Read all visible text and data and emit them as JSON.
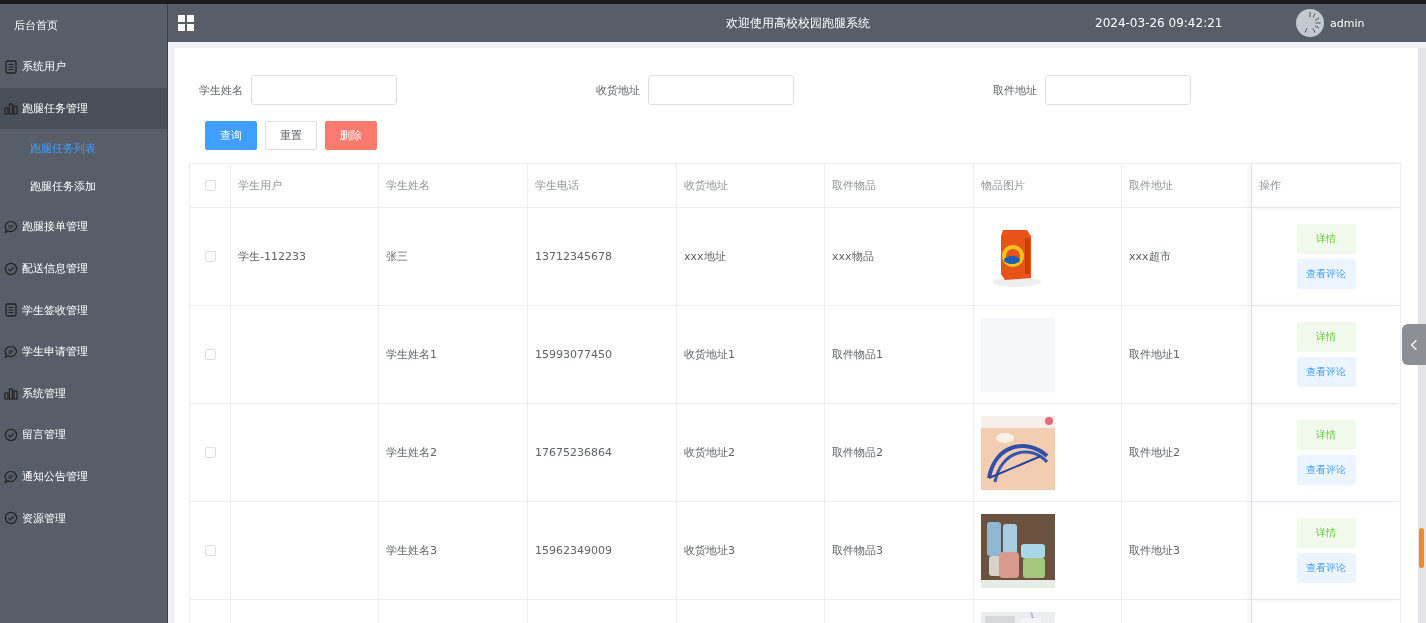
{
  "sidebar": {
    "home": "后台首页",
    "items": [
      {
        "label": "系统用户",
        "kind": "document",
        "expanded": false
      },
      {
        "label": "跑腿任务管理",
        "kind": "chart",
        "expanded": true,
        "children": [
          {
            "label": "跑腿任务列表",
            "selected": true
          },
          {
            "label": "跑腿任务添加",
            "selected": false
          }
        ]
      },
      {
        "label": "跑腿接单管理",
        "kind": "chat",
        "expanded": false
      },
      {
        "label": "配送信息管理",
        "kind": "check",
        "expanded": false
      },
      {
        "label": "学生签收管理",
        "kind": "document",
        "expanded": false
      },
      {
        "label": "学生申请管理",
        "kind": "chat",
        "expanded": false
      },
      {
        "label": "系统管理",
        "kind": "chart",
        "expanded": false
      },
      {
        "label": "留言管理",
        "kind": "check",
        "expanded": false
      },
      {
        "label": "通知公告管理",
        "kind": "chat",
        "expanded": false
      },
      {
        "label": "资源管理",
        "kind": "check",
        "expanded": false
      }
    ]
  },
  "header": {
    "title": "欢迎使用高校校园跑腿系统",
    "datetime": "2024-03-26 09:42:21",
    "user": "admin"
  },
  "filters": [
    {
      "label": "学生姓名"
    },
    {
      "label": "收货地址"
    },
    {
      "label": "取件地址"
    }
  ],
  "buttons": [
    {
      "label": "查询",
      "kind": "primary"
    },
    {
      "label": "重置",
      "kind": "plain"
    },
    {
      "label": "删除",
      "kind": "danger"
    }
  ],
  "table": {
    "header_checked": false,
    "columns": [
      "学生用户",
      "学生姓名",
      "学生电话",
      "收货地址",
      "取件物品",
      "物品图片",
      "取件地址",
      "操作"
    ],
    "rows": [
      {
        "checked": false,
        "cells": [
          "学生-112233",
          "张三",
          "13712345678",
          "xxx地址",
          "xxx物品"
        ],
        "image": {
          "kind": "picture"
        },
        "pickup": "xxx超市",
        "actions": [
          "详情",
          "查看评论"
        ]
      },
      {
        "checked": false,
        "cells": [
          "",
          "学生姓名1",
          "15993077450",
          "收货地址1",
          "取件物品1"
        ],
        "image": {
          "kind": "placeholder"
        },
        "pickup": "取件地址1",
        "actions": [
          "详情",
          "查看评论"
        ]
      },
      {
        "checked": false,
        "cells": [
          "",
          "学生姓名2",
          "17675236864",
          "收货地址2",
          "取件物品2"
        ],
        "image": {
          "kind": "picture"
        },
        "pickup": "取件地址2",
        "actions": [
          "详情",
          "查看评论"
        ]
      },
      {
        "checked": false,
        "cells": [
          "",
          "学生姓名3",
          "15962349009",
          "收货地址3",
          "取件物品3"
        ],
        "image": {
          "kind": "picture"
        },
        "pickup": "取件地址3",
        "actions": [
          "详情",
          "查看评论"
        ]
      },
      {
        "image": {
          "kind": "picture"
        }
      }
    ]
  }
}
